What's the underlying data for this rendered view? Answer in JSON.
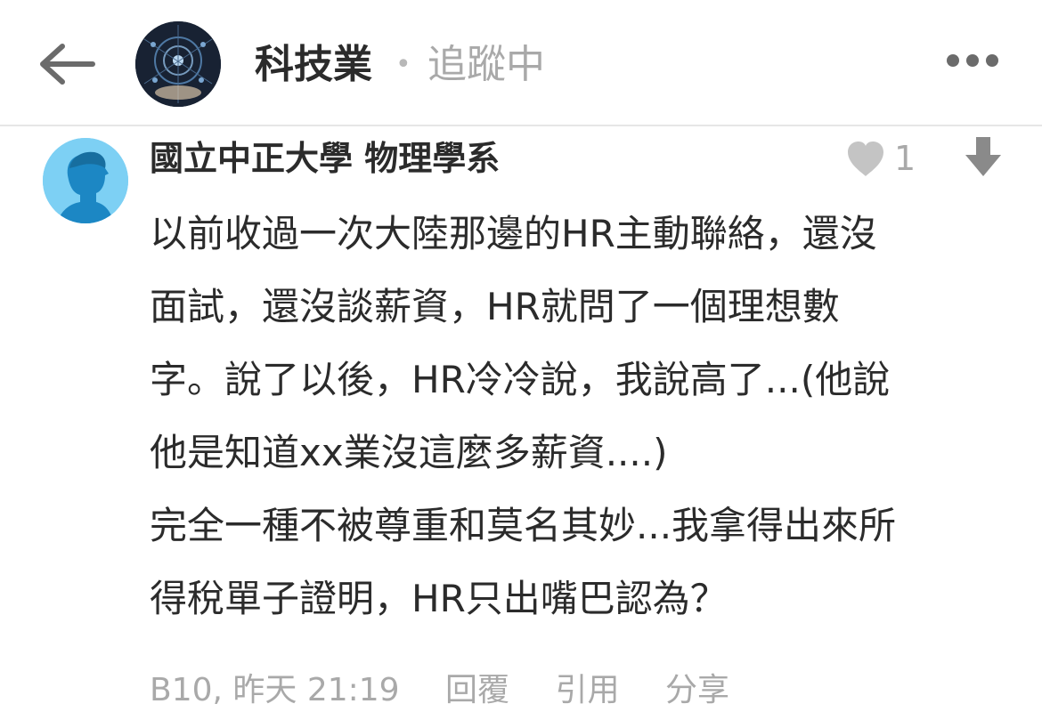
{
  "header": {
    "board_name": "科技業",
    "separator": "•",
    "follow_status": "追蹤中"
  },
  "comment": {
    "author": "國立中正大學 物理學系",
    "like_count": "1",
    "body_lines": [
      "以前收過一次大陸那邊的HR主動聯絡，還沒",
      "面試，還沒談薪資，HR就問了一個理想數",
      "字。說了以後，HR冷冷說，我說高了...(他說",
      "他是知道xx業沒這麼多薪資....)",
      "完全一種不被尊重和莫名其妙...我拿得出來所",
      "得稅單子證明，HR只出嘴巴認為？"
    ],
    "floor_time": "B10, 昨天 21:19",
    "actions": {
      "reply": "回覆",
      "quote": "引用",
      "share": "分享"
    }
  },
  "icons": {
    "back": "arrow-left-icon",
    "more": "more-horizontal-icon",
    "like": "heart-icon",
    "dislike": "arrow-down-icon"
  },
  "colors": {
    "text_primary": "#2b2b2b",
    "text_muted": "#a9a9a9",
    "avatar_bg": "#7dd0f4",
    "avatar_figure": "#1c87c4"
  }
}
